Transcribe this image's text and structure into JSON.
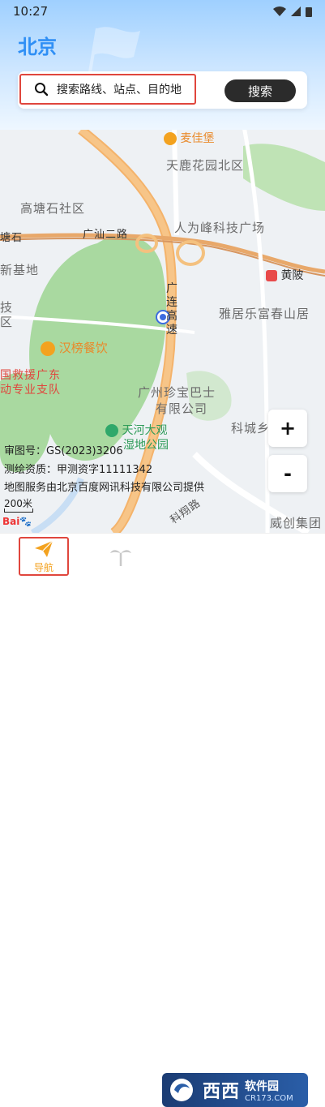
{
  "status_bar": {
    "time": "10:27"
  },
  "header": {
    "city": "北京"
  },
  "search": {
    "placeholder": "搜索路线、站点、目的地",
    "button_label": "搜索"
  },
  "map": {
    "labels": {
      "maijiabao": "麦佳堡",
      "tianluhuayuan": "天鹿花园北区",
      "gaotang": "高塘石社区",
      "guangshan": "广汕二路",
      "tangshi": "塘石",
      "renwei": "人为峰科技广场",
      "xinjidi": "新基地",
      "huangpi": "黄陂",
      "yaju": "雅居乐富春山居",
      "ji_qu": "技区",
      "hanbang": "汉榜餐饮",
      "guojiuyuan": "国救援广东",
      "zhuanye": "动专业支队",
      "guangzhou_zhenbao": "广州珍宝巴士",
      "youxian": "有限公司",
      "kecheng": "科城乡",
      "tianhe": "天河大观",
      "shidi": "湿地公园",
      "kexiang": "科翔路",
      "weichuang": "威创集团",
      "guangliangao": [
        "广",
        "连",
        "高",
        "速"
      ]
    },
    "zoom_in": "+",
    "zoom_out": "-",
    "info_lines": [
      "审图号：GS(2023)3206",
      "测绘资质：甲测资字11111342",
      "地图服务由北京百度网讯科技有限公司提供"
    ],
    "scale": "200米",
    "logo": "Bai"
  },
  "bottom_nav": {
    "nav_label": "导航"
  },
  "watermark": {
    "text": "西西",
    "subtext": "软件园",
    "domain": "CR173.COM"
  },
  "colors": {
    "accent": "#2f8ff5",
    "highlight": "#e0463d",
    "nav_active": "#f3a21f"
  }
}
